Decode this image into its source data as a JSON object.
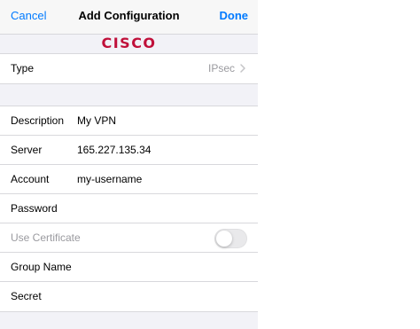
{
  "navbar": {
    "cancel_label": "Cancel",
    "title": "Add Configuration",
    "done_label": "Done",
    "accent_color": "#007aff"
  },
  "brand": {
    "logo_text": "CISCO",
    "logo_color": "#c0103a"
  },
  "type_row": {
    "label": "Type",
    "value": "IPsec",
    "icon": "chevron-right-icon"
  },
  "fields": {
    "description": {
      "label": "Description",
      "value": "My VPN"
    },
    "server": {
      "label": "Server",
      "value": "165.227.135.34"
    },
    "account": {
      "label": "Account",
      "value": "my-username"
    },
    "password": {
      "label": "Password",
      "value": ""
    },
    "use_certificate": {
      "label": "Use Certificate",
      "enabled": false
    },
    "group_name": {
      "label": "Group Name",
      "value": ""
    },
    "secret": {
      "label": "Secret",
      "value": ""
    }
  }
}
